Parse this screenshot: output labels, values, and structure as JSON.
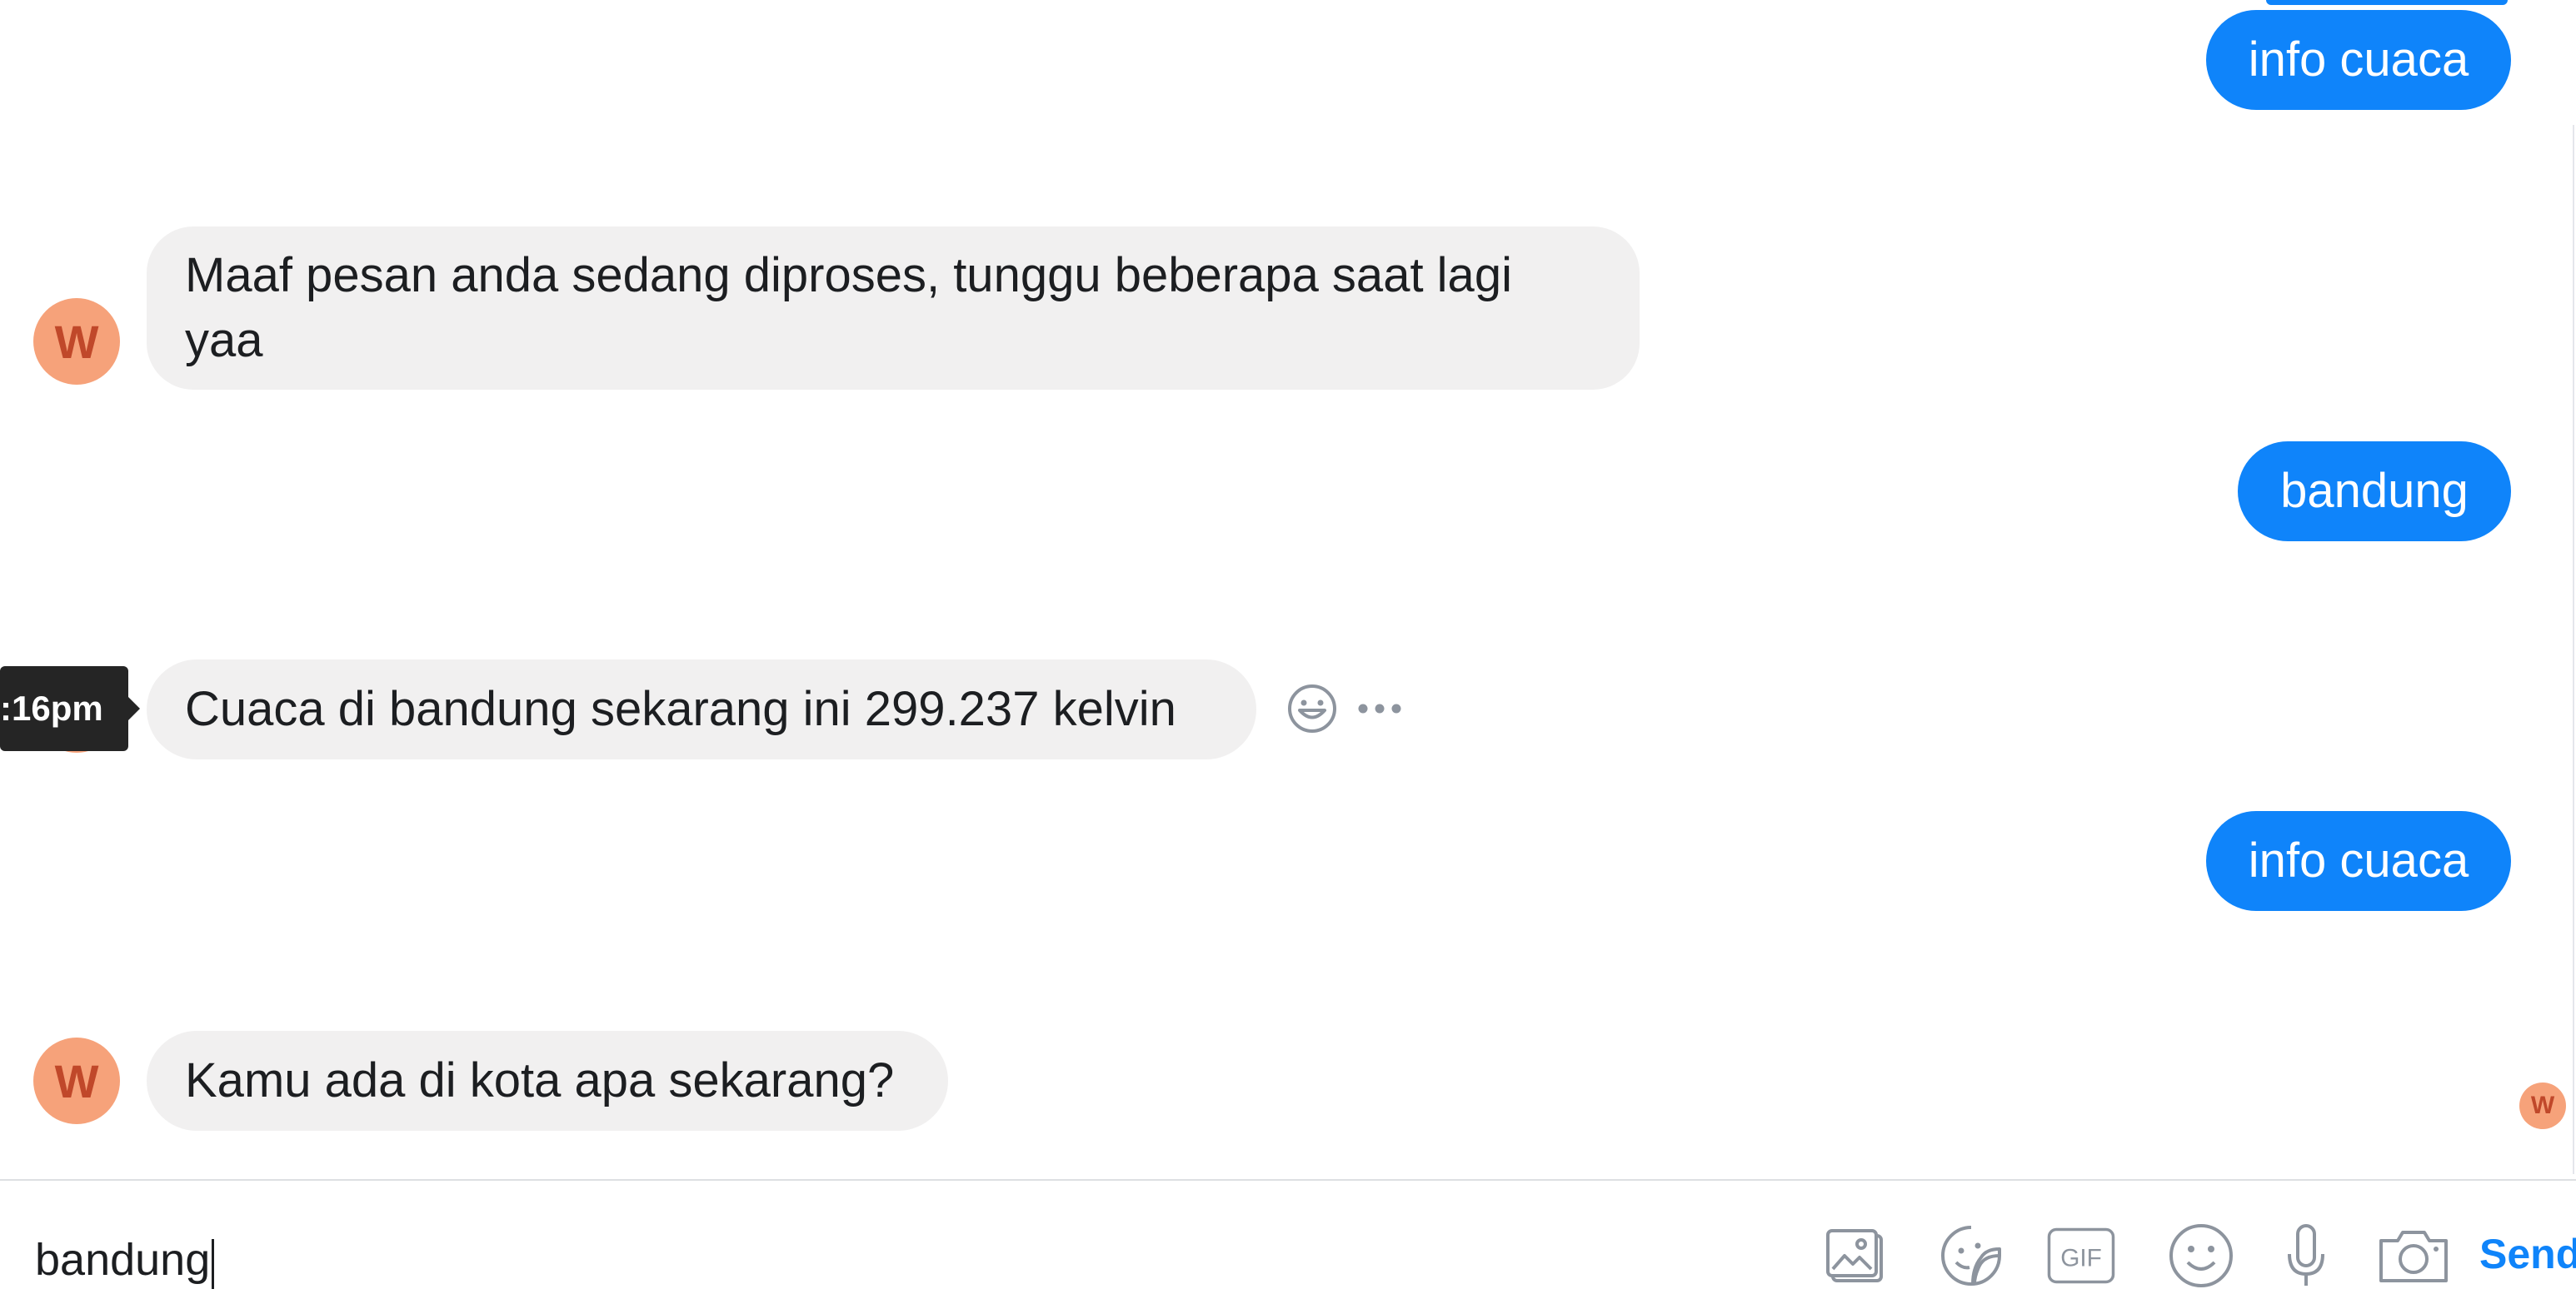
{
  "conversation": {
    "messages": [
      {
        "direction": "outgoing",
        "text": "info cuaca"
      },
      {
        "direction": "incoming",
        "text": "Maaf pesan anda sedang diproses, tunggu beberapa saat lagi yaa",
        "avatar": "W"
      },
      {
        "direction": "outgoing",
        "text": "bandung"
      },
      {
        "direction": "incoming",
        "text": "Cuaca di bandung sekarang ini 299.237 kelvin",
        "avatar": "W",
        "timestamp_tooltip": ":16pm"
      },
      {
        "direction": "outgoing",
        "text": "info cuaca"
      },
      {
        "direction": "incoming",
        "text": "Kamu ada di kota apa sekarang?",
        "avatar": "W"
      }
    ],
    "seen_avatar": "W"
  },
  "composer": {
    "value": "bandung",
    "send_label": "Send",
    "tools": [
      "photo-icon",
      "sticker-icon",
      "gif-icon",
      "emoji-icon",
      "microphone-icon",
      "camera-icon"
    ],
    "gif_label": "GIF"
  },
  "colors": {
    "outgoing_bubble": "#0f84fa",
    "incoming_bubble": "#f1f0f0",
    "avatar_bg": "#f6a27a",
    "avatar_text": "#c0482a",
    "send": "#0f84fa"
  }
}
